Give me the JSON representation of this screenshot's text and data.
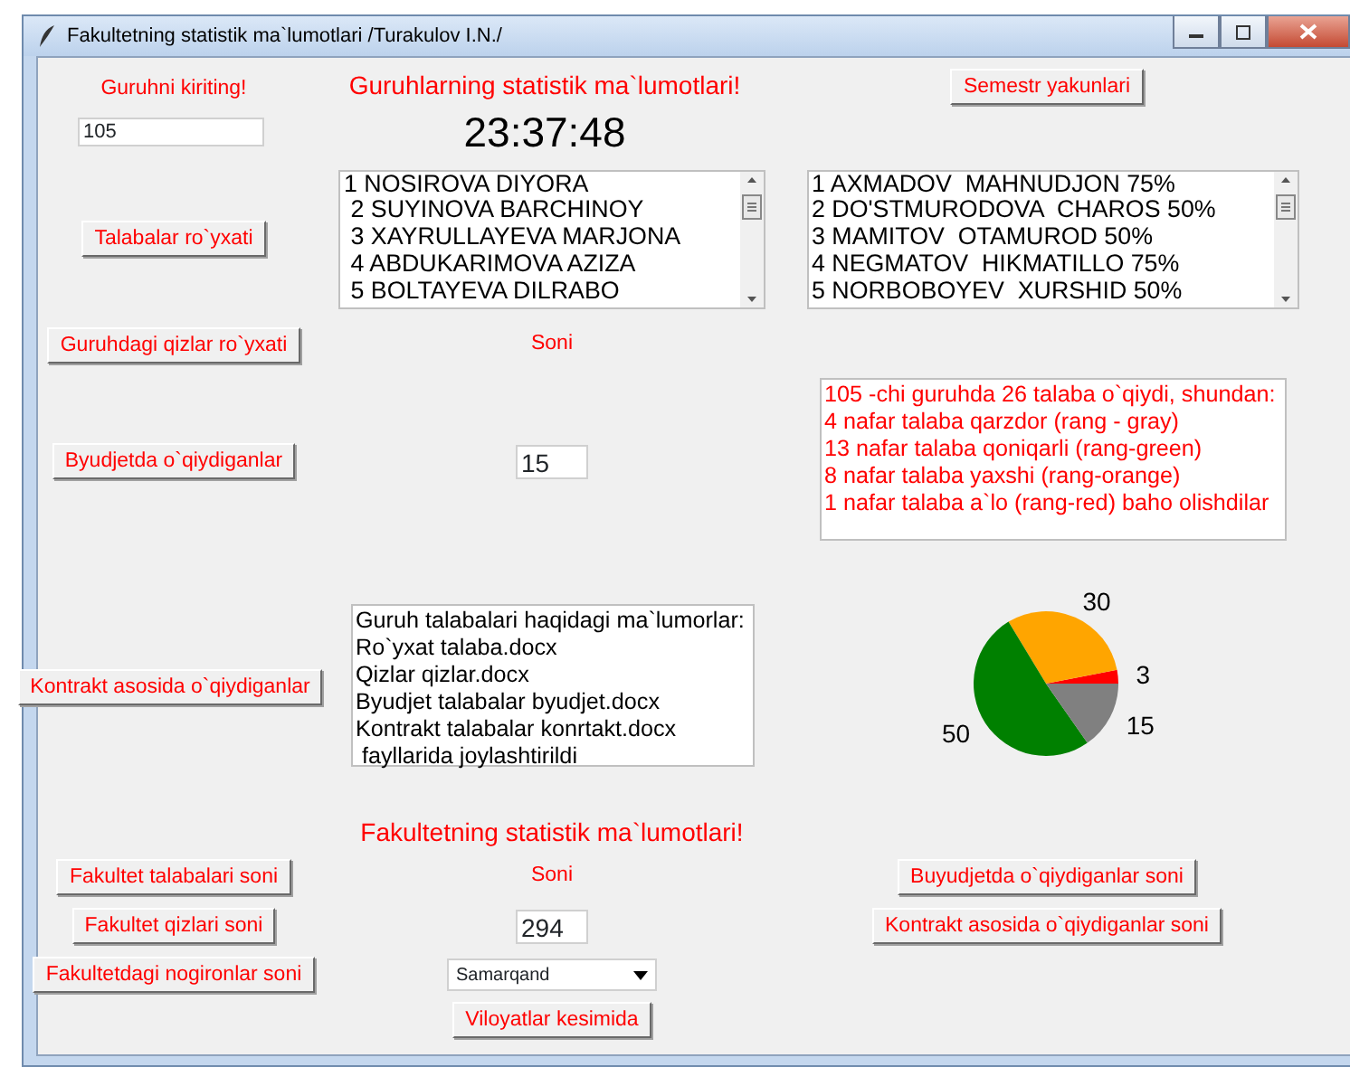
{
  "window": {
    "title": "Fakultetning statistik ma`lumotlari /Turakulov I.N./"
  },
  "group_label": "Guruhni kiriting!",
  "group_title": "Guruhlarning statistik ma`lumotlari!",
  "semester_button": "Semestr yakunlari",
  "group_input": {
    "value": "105"
  },
  "clock": "23:37:48",
  "students_button": "Talabalar ro`yxati",
  "students_list": [
    "1 NOSIROVA DIYORA",
    " 2 SUYINOVA BARCHINOY",
    " 3 XAYRULLAYEVA MARJONA",
    " 4 ABDUKARIMOVA AZIZA",
    " 5 BOLTAYEVA DILRABO"
  ],
  "grades_list": [
    "1 AXMADOV  MAHNUDJON 75%",
    "2 DO'STMURODOVA  CHAROS 50%",
    "3 MAMITOV  OTAMUROD 50%",
    "4 NEGMATOV  HIKMATILLO 75%",
    "5 NORBOBOYEV  XURSHID 50%"
  ],
  "girls_button": "Guruhdagi qizlar ro`yxati",
  "count_label": "Soni",
  "budget_button": "Byudjetda o`qiydiganlar",
  "budget_count": {
    "value": "15"
  },
  "summary_text": [
    "105 -chi guruhda 26 talaba o`qiydi, shundan:",
    "4 nafar talaba qarzdor (rang - gray)",
    "13 nafar talaba qoniqarli (rang-green)",
    "8 nafar talaba yaxshi (rang-orange)",
    "1 nafar talaba a`lo (rang-red) baho olishdilar"
  ],
  "contract_button": "Kontrakt asosida o`qiydiganlar",
  "files_text": [
    "Guruh talabalari haqidagi ma`lumorlar:",
    "Ro`yxat talaba.docx",
    "Qizlar qizlar.docx",
    "Byudjet talabalar byudjet.docx",
    "Kontrakt talabalar konrtakt.docx",
    " fayllarida joylashtirildi"
  ],
  "chart_data": {
    "type": "pie",
    "data_labels": true,
    "values": [
      3,
      30,
      50,
      15
    ],
    "colors": [
      "#ff0000",
      "#ffa500",
      "#008000",
      "#808080"
    ]
  },
  "faculty_title": "Fakultetning statistik ma`lumotlari!",
  "faculty_buttons_left": [
    "Fakultet talabalari soni",
    "Fakultet qizlari soni",
    "Fakultetdagi nogironlar soni"
  ],
  "faculty_count_label": "Soni",
  "faculty_count": {
    "value": "294"
  },
  "faculty_buttons_right": [
    "Buyudjetda o`qiydiganlar soni",
    "Kontrakt asosida o`qiydiganlar soni"
  ],
  "region_select": {
    "value": "Samarqand"
  },
  "region_button": "Viloyatlar kesimida"
}
